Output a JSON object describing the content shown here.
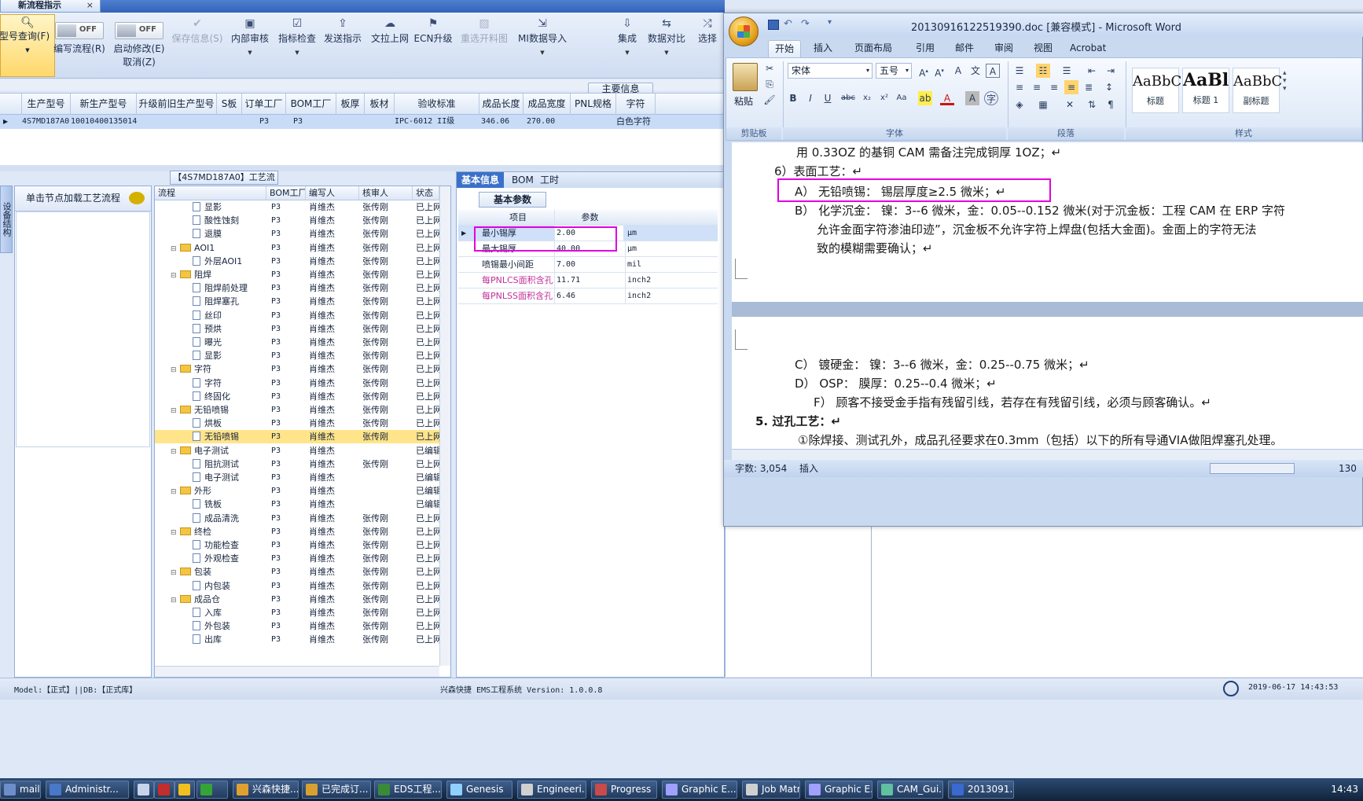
{
  "left_app": {
    "tab_title": "新流程指示",
    "tab_close": "×",
    "ribbon": {
      "search": "型号查询(F)",
      "edit_flow_toggle": "OFF",
      "edit_flow": "编写流程(R)",
      "enable_edit_toggle": "OFF",
      "enable_edit": "启动修改(E)",
      "cancel": "取消(Z)",
      "save_info": "保存信息(S)",
      "internal_audit": "内部审核",
      "indicator_check": "指标检查",
      "send_indicator": "发送指示",
      "upload_text": "文拉上网",
      "ecn_upgrade": "ECN升级",
      "reselect_image": "重选开料图",
      "mi_import": "MI数据导入",
      "integrate": "集成",
      "data_compare": "数据对比",
      "select": "选择"
    },
    "main_info_label": "主要信息",
    "grid": {
      "headers": [
        "生产型号",
        "新生产型号",
        "升级前旧生产型号",
        "S板",
        "订单工厂",
        "BOM工厂",
        "板厚",
        "板材",
        "验收标准",
        "成品长度",
        "成品宽度",
        "PNL规格",
        "字符"
      ],
      "row": [
        "4S7MD187A0",
        "10010400135014",
        "",
        "",
        "P3",
        "P3",
        "",
        "",
        "IPC-6012 II级",
        "346.06",
        "270.00",
        "",
        "白色字符"
      ]
    },
    "flow_caption": "【4S7MD187A0】工艺流程",
    "vertical_tab": "设备结构",
    "left_panel_header": "单击节点加载工艺流程",
    "tree": {
      "headers": [
        "流程",
        "BOM工厂",
        "编写人",
        "核审人",
        "状态"
      ],
      "rows": [
        {
          "name": "显影",
          "level": 2,
          "folder": false,
          "bom": "P3",
          "writer": "肖维杰",
          "reviewer": "张传刚",
          "status": "已上网"
        },
        {
          "name": "酸性蚀刻",
          "level": 2,
          "folder": false,
          "bom": "P3",
          "writer": "肖维杰",
          "reviewer": "张传刚",
          "status": "已上网"
        },
        {
          "name": "退膜",
          "level": 2,
          "folder": false,
          "bom": "P3",
          "writer": "肖维杰",
          "reviewer": "张传刚",
          "status": "已上网"
        },
        {
          "name": "AOI1",
          "level": 1,
          "folder": true,
          "bom": "P3",
          "writer": "肖维杰",
          "reviewer": "张传刚",
          "status": "已上网"
        },
        {
          "name": "外层AOI1",
          "level": 2,
          "folder": false,
          "bom": "P3",
          "writer": "肖维杰",
          "reviewer": "张传刚",
          "status": "已上网"
        },
        {
          "name": "阻焊",
          "level": 1,
          "folder": true,
          "bom": "P3",
          "writer": "肖维杰",
          "reviewer": "张传刚",
          "status": "已上网"
        },
        {
          "name": "阻焊前处理",
          "level": 2,
          "folder": false,
          "bom": "P3",
          "writer": "肖维杰",
          "reviewer": "张传刚",
          "status": "已上网"
        },
        {
          "name": "阻焊塞孔",
          "level": 2,
          "folder": false,
          "bom": "P3",
          "writer": "肖维杰",
          "reviewer": "张传刚",
          "status": "已上网"
        },
        {
          "name": "丝印",
          "level": 2,
          "folder": false,
          "bom": "P3",
          "writer": "肖维杰",
          "reviewer": "张传刚",
          "status": "已上网"
        },
        {
          "name": "预烘",
          "level": 2,
          "folder": false,
          "bom": "P3",
          "writer": "肖维杰",
          "reviewer": "张传刚",
          "status": "已上网"
        },
        {
          "name": "曝光",
          "level": 2,
          "folder": false,
          "bom": "P3",
          "writer": "肖维杰",
          "reviewer": "张传刚",
          "status": "已上网"
        },
        {
          "name": "显影",
          "level": 2,
          "folder": false,
          "bom": "P3",
          "writer": "肖维杰",
          "reviewer": "张传刚",
          "status": "已上网"
        },
        {
          "name": "字符",
          "level": 1,
          "folder": true,
          "bom": "P3",
          "writer": "肖维杰",
          "reviewer": "张传刚",
          "status": "已上网"
        },
        {
          "name": "字符",
          "level": 2,
          "folder": false,
          "bom": "P3",
          "writer": "肖维杰",
          "reviewer": "张传刚",
          "status": "已上网"
        },
        {
          "name": "终固化",
          "level": 2,
          "folder": false,
          "bom": "P3",
          "writer": "肖维杰",
          "reviewer": "张传刚",
          "status": "已上网"
        },
        {
          "name": "无铅喷锡",
          "level": 1,
          "folder": true,
          "bom": "P3",
          "writer": "肖维杰",
          "reviewer": "张传刚",
          "status": "已上网"
        },
        {
          "name": "烘板",
          "level": 2,
          "folder": false,
          "bom": "P3",
          "writer": "肖维杰",
          "reviewer": "张传刚",
          "status": "已上网"
        },
        {
          "name": "无铅喷锡",
          "level": 2,
          "folder": false,
          "bom": "P3",
          "writer": "肖维杰",
          "reviewer": "张传刚",
          "status": "已上网",
          "selected": true
        },
        {
          "name": "电子测试",
          "level": 1,
          "folder": true,
          "bom": "P3",
          "writer": "肖维杰",
          "reviewer": "",
          "status": "已编辑"
        },
        {
          "name": "阻抗测试",
          "level": 2,
          "folder": false,
          "bom": "P3",
          "writer": "肖维杰",
          "reviewer": "张传刚",
          "status": "已上网"
        },
        {
          "name": "电子测试",
          "level": 2,
          "folder": false,
          "bom": "P3",
          "writer": "肖维杰",
          "reviewer": "",
          "status": "已编辑"
        },
        {
          "name": "外形",
          "level": 1,
          "folder": true,
          "bom": "P3",
          "writer": "肖维杰",
          "reviewer": "",
          "status": "已编辑"
        },
        {
          "name": "铣板",
          "level": 2,
          "folder": false,
          "bom": "P3",
          "writer": "肖维杰",
          "reviewer": "",
          "status": "已编辑"
        },
        {
          "name": "成品清洗",
          "level": 2,
          "folder": false,
          "bom": "P3",
          "writer": "肖维杰",
          "reviewer": "张传刚",
          "status": "已上网"
        },
        {
          "name": "终检",
          "level": 1,
          "folder": true,
          "bom": "P3",
          "writer": "肖维杰",
          "reviewer": "张传刚",
          "status": "已上网"
        },
        {
          "name": "功能检查",
          "level": 2,
          "folder": false,
          "bom": "P3",
          "writer": "肖维杰",
          "reviewer": "张传刚",
          "status": "已上网"
        },
        {
          "name": "外观检查",
          "level": 2,
          "folder": false,
          "bom": "P3",
          "writer": "肖维杰",
          "reviewer": "张传刚",
          "status": "已上网"
        },
        {
          "name": "包装",
          "level": 1,
          "folder": true,
          "bom": "P3",
          "writer": "肖维杰",
          "reviewer": "张传刚",
          "status": "已上网"
        },
        {
          "name": "内包装",
          "level": 2,
          "folder": false,
          "bom": "P3",
          "writer": "肖维杰",
          "reviewer": "张传刚",
          "status": "已上网"
        },
        {
          "name": "成品仓",
          "level": 1,
          "folder": true,
          "bom": "P3",
          "writer": "肖维杰",
          "reviewer": "张传刚",
          "status": "已上网"
        },
        {
          "name": "入库",
          "level": 2,
          "folder": false,
          "bom": "P3",
          "writer": "肖维杰",
          "reviewer": "张传刚",
          "status": "已上网"
        },
        {
          "name": "外包装",
          "level": 2,
          "folder": false,
          "bom": "P3",
          "writer": "肖维杰",
          "reviewer": "张传刚",
          "status": "已上网"
        },
        {
          "name": "出库",
          "level": 2,
          "folder": false,
          "bom": "P3",
          "writer": "肖维杰",
          "reviewer": "张传刚",
          "status": "已上网"
        }
      ]
    },
    "props": {
      "tabs": [
        "基本信息",
        "BOM",
        "工时"
      ],
      "sub_tab": "基本参数",
      "headers": [
        "项目",
        "参数"
      ],
      "rows": [
        {
          "key": "最小锡厚",
          "value": "2.00",
          "unit": "μm"
        },
        {
          "key": "最大锡厚",
          "value": "40.00",
          "unit": "μm"
        },
        {
          "key": "喷锡最小间距",
          "value": "7.00",
          "unit": "mil"
        },
        {
          "key": "每PNLCS面积含孔",
          "value": "11.71",
          "unit": "inch2"
        },
        {
          "key": "每PNLSS面积含孔",
          "value": "6.46",
          "unit": "inch2"
        }
      ]
    },
    "status": {
      "model_db": "Model:【正式】||DB:【正式库】",
      "system": "兴森快捷 EMS工程系统 Version: 1.0.0.8",
      "datetime": "2019-06-17 14:43:53"
    }
  },
  "word": {
    "title": "20130916122519390.doc [兼容模式] - Microsoft Word",
    "tabs": [
      "开始",
      "插入",
      "页面布局",
      "引用",
      "邮件",
      "审阅",
      "视图",
      "Acrobat"
    ],
    "font_name": "宋体",
    "font_size": "五号",
    "paste_label": "粘贴",
    "groups": [
      "剪贴板",
      "字体",
      "段落",
      "样式"
    ],
    "styles": [
      {
        "sample": "AaBbC",
        "name": "标题"
      },
      {
        "sample": "AaBl",
        "name": "标题 1"
      },
      {
        "sample": "AaBbC",
        "name": "副标题"
      }
    ],
    "page1_lines": [
      "用 0.33OZ 的基铜 CAM 需备注完成铜厚 1OZ；↵",
      "6）表面工艺：↵",
      "A） 无铅喷锡： 锡层厚度≥2.5 微米；↵",
      "B） 化学沉金： 镍：3--6 微米，金：0.05--0.152 微米(对于沉金板：工程 CAM 在 ERP 字符",
      "允许金面字符渗油印迹”，沉金板不允许字符上焊盘(包括大金面)。金面上的字符无法",
      "致的模糊需要确认；↵"
    ],
    "page2_lines": [
      "C） 镀硬金：    镍：3--6 微米，金：0.25--0.75 微米；↵",
      "D） OSP：       膜厚：0.25--0.4 微米；↵",
      "F） 顾客不接受金手指有残留引线，若存在有残留引线，必须与顾客确认。↵",
      "5.  过孔工艺：↵",
      "①除焊接、测试孔外，成品孔径要求在0.3mm（包括）以下的所有导通VIA做阻焊塞孔处理。"
    ],
    "status_words": "字数: 3,054",
    "status_insert": "插入",
    "zoom": "130"
  },
  "taskbar": {
    "items": [
      "mail",
      "Administr...",
      "",
      "",
      "",
      "",
      "兴森快捷...",
      "已完成订...",
      "EDS工程...",
      "Genesis",
      "Engineeri...",
      "Progress",
      "Graphic E...",
      "Job Matr...",
      "Graphic E...",
      "CAM_Gui...",
      "2013091..."
    ],
    "clock": "14:43"
  },
  "colors": {
    "highlight": "#e100e1",
    "selection": "#ffe48a",
    "accent": "#3a70c9"
  }
}
